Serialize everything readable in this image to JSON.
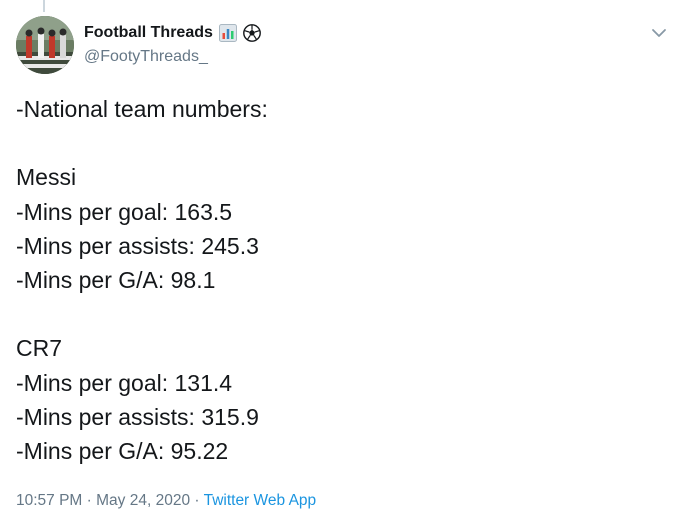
{
  "author": {
    "display_name": "Football Threads",
    "handle": "@FootyThreads_",
    "emoji_icons": [
      "bar-chart-icon",
      "soccer-ball-icon"
    ]
  },
  "tweet": {
    "lines": [
      "-National team numbers:",
      "",
      "Messi",
      "-Mins per goal: 163.5",
      "-Mins per assists: 245.3",
      "-Mins per G/A: 98.1",
      "",
      "CR7",
      "-Mins per goal: 131.4",
      "-Mins per assists: 315.9",
      "-Mins per G/A: 95.22"
    ]
  },
  "meta": {
    "time": "10:57 PM",
    "separator1": " · ",
    "date": "May 24, 2020",
    "separator2": " · ",
    "source": "Twitter Web App"
  },
  "colors": {
    "text": "#14171a",
    "secondary": "#657786",
    "link": "#1b95e0"
  }
}
